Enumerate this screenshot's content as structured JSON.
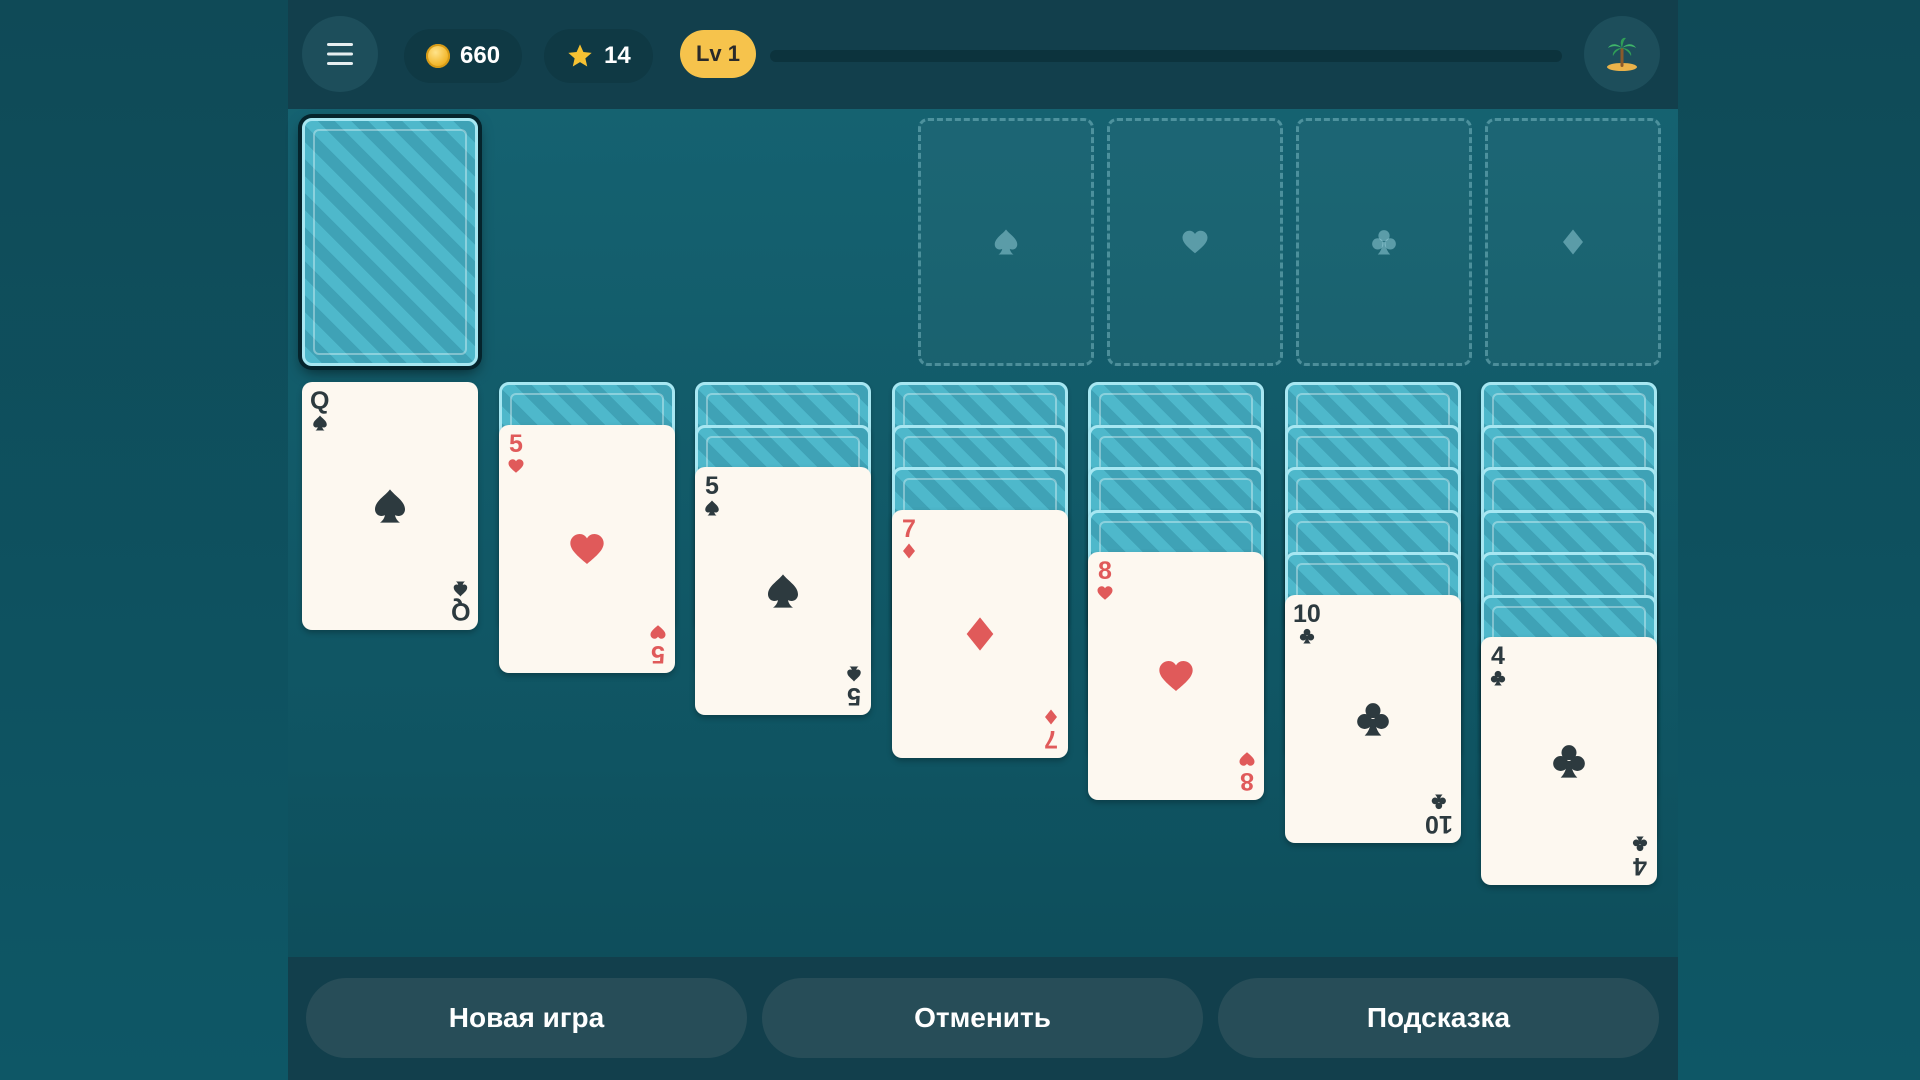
{
  "header": {
    "menu_icon": "hamburger-menu-icon",
    "coins": {
      "icon": "coin-icon",
      "value": "660"
    },
    "stars": {
      "icon": "star-icon",
      "value": "14"
    },
    "level": {
      "label": "Lv 1",
      "progress": 0.0
    },
    "theme_icon": "palm-island-icon"
  },
  "stock": {
    "cards": 1,
    "face": "down"
  },
  "foundations": [
    {
      "suit": "spades",
      "icon": "spade-icon"
    },
    {
      "suit": "hearts",
      "icon": "heart-icon"
    },
    {
      "suit": "clubs",
      "icon": "club-icon"
    },
    {
      "suit": "diamonds",
      "icon": "diamond-icon"
    }
  ],
  "tableau": [
    {
      "hidden": 0,
      "top": {
        "rank": "Q",
        "suit": "spades",
        "color": "black"
      }
    },
    {
      "hidden": 1,
      "top": {
        "rank": "5",
        "suit": "hearts",
        "color": "red"
      }
    },
    {
      "hidden": 2,
      "top": {
        "rank": "5",
        "suit": "spades",
        "color": "black"
      }
    },
    {
      "hidden": 3,
      "top": {
        "rank": "7",
        "suit": "diamonds",
        "color": "red"
      }
    },
    {
      "hidden": 4,
      "top": {
        "rank": "8",
        "suit": "hearts",
        "color": "red"
      }
    },
    {
      "hidden": 5,
      "top": {
        "rank": "10",
        "suit": "clubs",
        "color": "black"
      }
    },
    {
      "hidden": 6,
      "top": {
        "rank": "4",
        "suit": "clubs",
        "color": "black"
      }
    }
  ],
  "actions": {
    "new_game": "Новая игра",
    "undo": "Отменить",
    "hint": "Подсказка"
  },
  "colors": {
    "red_suit": "#e05a5a",
    "black_suit": "#2d3a3f",
    "level_badge": "#f6c34c",
    "card_back": "#4eb8cb"
  }
}
